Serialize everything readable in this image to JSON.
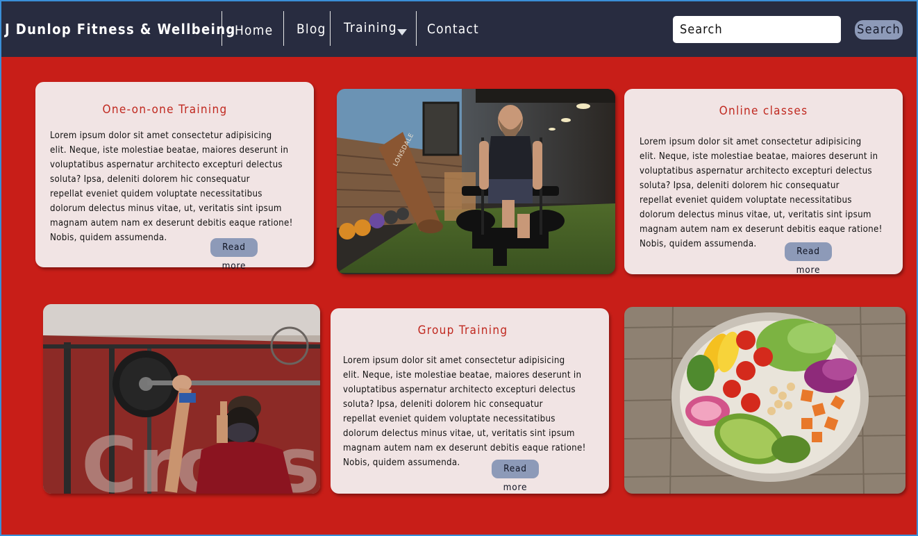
{
  "nav": {
    "brand": "J Dunlop Fitness & Wellbeing",
    "links": [
      {
        "label": "Home"
      },
      {
        "label": "Blog"
      },
      {
        "label": "Training",
        "icon": "caret-down-icon"
      },
      {
        "label": "Contact"
      }
    ],
    "search": {
      "placeholder": "Search",
      "button_label": "Search"
    }
  },
  "cards": [
    {
      "title": "One-on-one Training",
      "lines": [
        "Lorem ipsum dolor sit amet consectetur adipisicing",
        "elit. Neque, iste molestiae beatae, maiores deserunt in",
        "voluptatibus aspernatur architecto excepturi delectus",
        "soluta? Ipsa, deleniti dolorem hic consequatur",
        "repellat eveniet quidem voluptate necessitatibus",
        "dolorum delectus minus vitae, ut, veritatis sint ipsum",
        "magnam autem nam ex deserunt debitis eaque ratione!",
        "Nobis, quidem assumenda."
      ],
      "button": "Read more"
    },
    {
      "title": "Online classes",
      "lines": [
        "Lorem ipsum dolor sit amet consectetur adipisicing",
        "elit. Neque, iste molestiae beatae, maiores deserunt in",
        "voluptatibus aspernatur architecto excepturi delectus",
        "soluta? Ipsa, deleniti dolorem hic consequatur",
        "repellat eveniet quidem voluptate necessitatibus",
        "dolorum delectus minus vitae, ut, veritatis sint ipsum",
        "magnam autem nam ex deserunt debitis eaque ratione!",
        "Nobis, quidem assumenda."
      ],
      "button": "Read more"
    },
    {
      "title": "Group Training",
      "lines": [
        "Lorem ipsum dolor sit amet consectetur adipisicing",
        "elit. Neque, iste molestiae beatae, maiores deserunt in",
        "voluptatibus aspernatur architecto excepturi delectus",
        "soluta? Ipsa, deleniti dolorem hic consequatur",
        "repellat eveniet quidem voluptate necessitatibus",
        "dolorum delectus minus vitae, ut, veritatis sint ipsum",
        "magnam autem nam ex deserunt debitis eaque ratione!",
        "Nobis, quidem assumenda."
      ],
      "button": "Read more"
    }
  ],
  "images": [
    {
      "name": "sled-push-photo",
      "text": "LONSDALE"
    },
    {
      "name": "barbell-overhead-photo"
    },
    {
      "name": "salad-bowl-photo"
    }
  ],
  "colors": {
    "nav_bg": "#282c40",
    "page_bg": "#c81e18",
    "card_bg": "#f1e4e4",
    "card_title": "#c0281f",
    "button_bg": "#8d9ab8",
    "frame_border": "#3a8fd8"
  }
}
